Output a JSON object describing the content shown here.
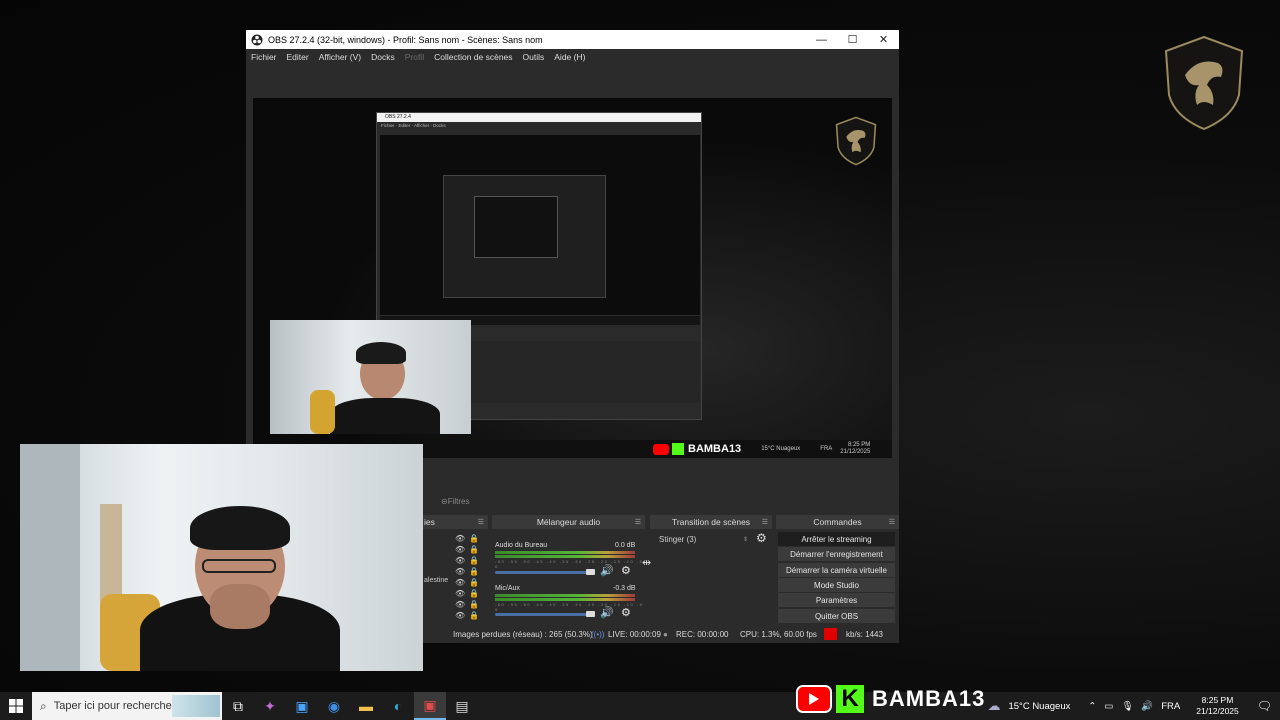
{
  "obs": {
    "title": "OBS 27.2.4 (32-bit, windows) - Profil: Sans nom - Scènes: Sans nom",
    "menu": [
      "Fichier",
      "Editer",
      "Afficher (V)",
      "Docks",
      "Profil",
      "Collection de scènes",
      "Outils",
      "Aide (H)"
    ],
    "controls": {
      "minimize": "—",
      "maximize": "☐",
      "close": "✕"
    },
    "partial_tabs": {
      "scenes": "ies",
      "filters": "Filtres",
      "sources_tab": ""
    },
    "docks": {
      "mixer": {
        "title": "Mélangeur audio",
        "tracks": [
          {
            "name": "Audio du Bureau",
            "db": "0.0 dB"
          },
          {
            "name": "Mic/Aux",
            "db": "-0.3 dB"
          }
        ],
        "ticks": "-60 -55 -50 -45 -40 -35 -30 -25 -20 -15 -10 -5 0"
      },
      "transition": {
        "title": "Transition de scènes",
        "selected": "Stinger (3)"
      },
      "commands": {
        "title": "Commandes",
        "buttons": [
          "Arrêter le streaming",
          "Démarrer l'enregistrement",
          "Démarrer la caméra virtuelle",
          "Mode Studio",
          "Paramètres",
          "Quitter OBS"
        ]
      },
      "sources_partial": [
        "alestine"
      ]
    },
    "status": {
      "dropped": "Images perdues (réseau) : 265 (50.3%)",
      "live": "LIVE: 00:00:09",
      "rec": "REC: 00:00:00",
      "cpu": "CPU: 1.3%, 60.00 fps",
      "kbs": "kb/s: 1443"
    }
  },
  "preview_overlay": {
    "brand": "BAMBA13",
    "weather": "15°C  Nuageux",
    "time": "8:25 PM",
    "date": "21/12/2025",
    "lang": "FRA"
  },
  "taskbar": {
    "search_placeholder": "Taper ici pour rechercher",
    "brand": "BAMBA13",
    "weather": "15°C  Nuageux",
    "lang": "FRA",
    "time": "8:25 PM",
    "date": "21/12/2025"
  },
  "colors": {
    "accent_red": "#e50000",
    "brand_green": "#53fc18",
    "youtube_red": "#ff0000"
  }
}
